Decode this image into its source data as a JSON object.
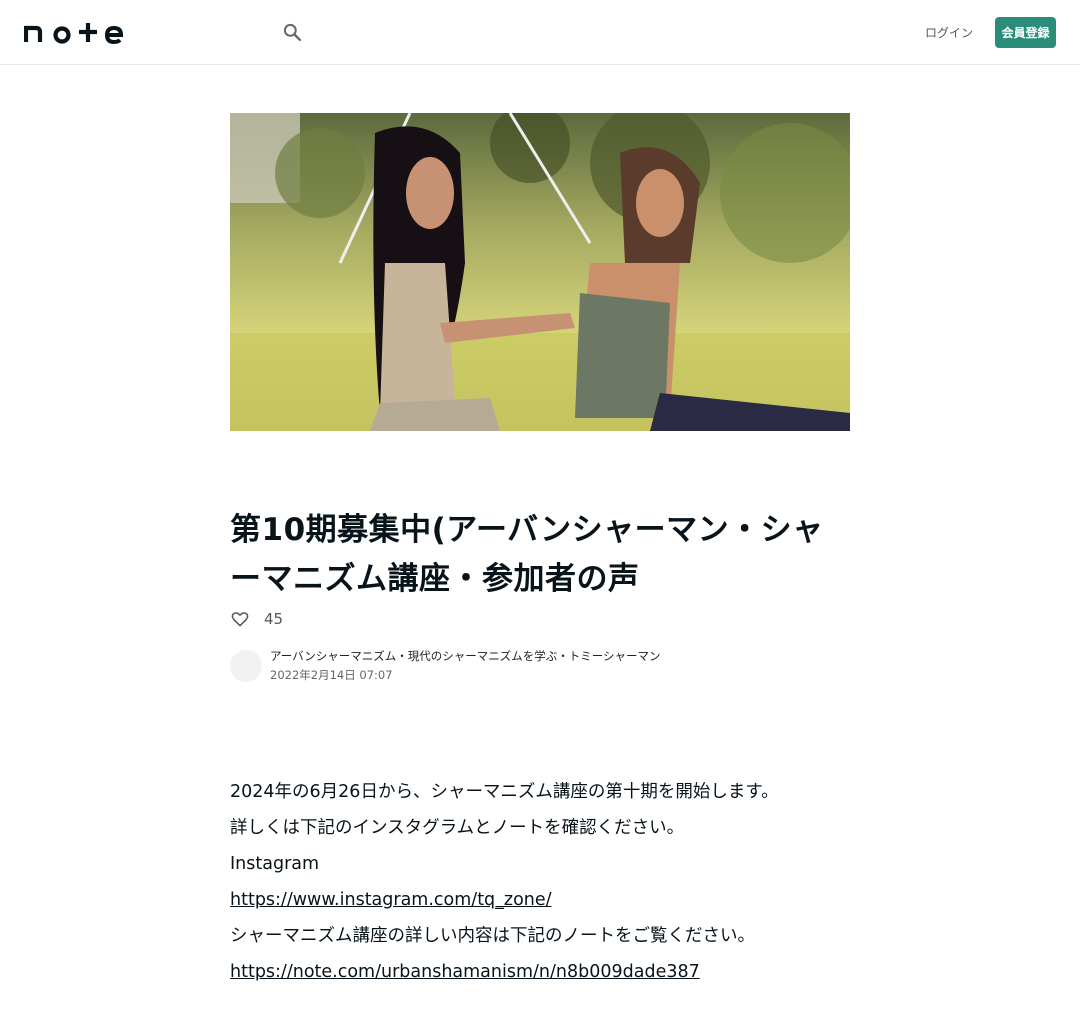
{
  "header": {
    "logo_text": "note",
    "search_icon": "search-icon",
    "login_label": "ログイン",
    "signup_label": "会員登録"
  },
  "hero": {
    "image": "two-women-garden-photo"
  },
  "article": {
    "title": "第10期募集中(アーバンシャーマン・シャーマニズム講座・参加者の声",
    "like_icon": "heart-outline-icon",
    "like_count": "45",
    "author_name": "アーバンシャーマニズム・現代のシャーマニズムを学ぶ・トミーシャーマン",
    "date": "2022年2月14日 07:07",
    "body": [
      {
        "type": "text",
        "text": "2024年の6月26日から、シャーマニズム講座の第十期を開始します。"
      },
      {
        "type": "text",
        "text": "詳しくは下記のインスタグラムとノートを確認ください。"
      },
      {
        "type": "text",
        "text": "Instagram"
      },
      {
        "type": "link",
        "text": "https://www.instagram.com/tq_zone/"
      },
      {
        "type": "text",
        "text": "シャーマニズム講座の詳しい内容は下記のノートをご覧ください。"
      },
      {
        "type": "link",
        "text": "https://note.com/urbanshamanism/n/n8b009dade387"
      }
    ]
  },
  "colors": {
    "brand_green": "#2a8d7a",
    "text": "#08131a"
  }
}
